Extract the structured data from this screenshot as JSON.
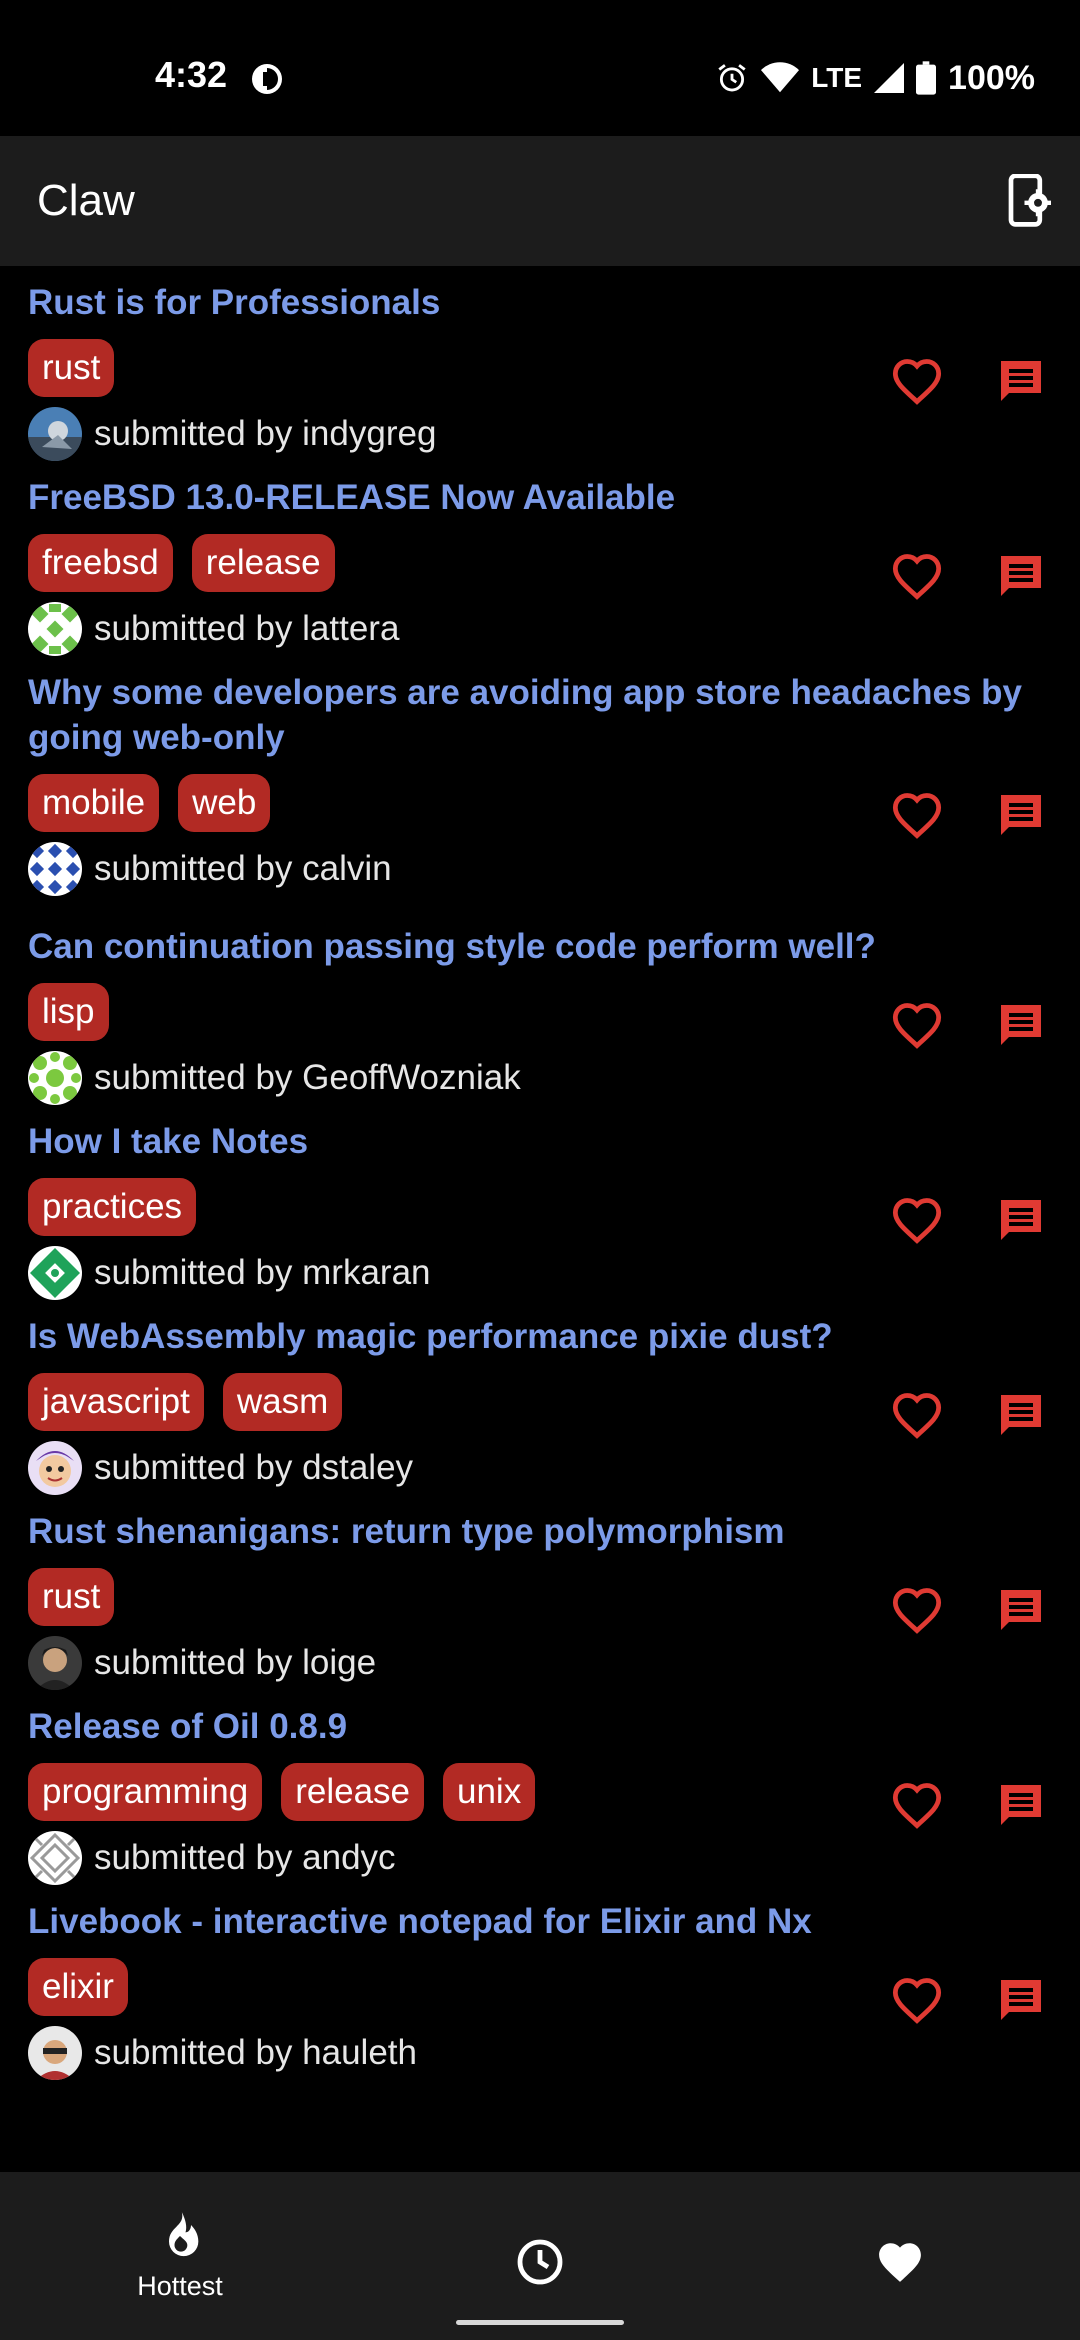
{
  "status_bar": {
    "time": "4:32",
    "network": "LTE",
    "battery": "100%",
    "icons": [
      "alarm-icon",
      "wifi-icon",
      "signal-icon",
      "battery-icon"
    ]
  },
  "app_bar": {
    "title": "Claw",
    "settings_icon": "app-settings-icon"
  },
  "colors": {
    "background": "#000000",
    "bar": "#1c1c1c",
    "title": "#7c9be8",
    "tag": "#b22a24",
    "accent": "#e03a33"
  },
  "stories": [
    {
      "title": "Rust is for Professionals",
      "tags": [
        "rust"
      ],
      "byline": "submitted by indygreg"
    },
    {
      "title": "FreeBSD 13.0-RELEASE Now Available",
      "tags": [
        "freebsd",
        "release"
      ],
      "byline": "submitted by lattera"
    },
    {
      "title": "Why some developers are avoiding app store headaches by going web-only",
      "tags": [
        "mobile",
        "web"
      ],
      "byline": "submitted by calvin"
    },
    {
      "title": "Can continuation passing style code perform well?",
      "tags": [
        "lisp"
      ],
      "byline": "submitted by GeoffWozniak"
    },
    {
      "title": "How I take Notes",
      "tags": [
        "practices"
      ],
      "byline": "submitted by mrkaran"
    },
    {
      "title": "Is WebAssembly magic performance pixie dust?",
      "tags": [
        "javascript",
        "wasm"
      ],
      "byline": "submitted by dstaley"
    },
    {
      "title": "Rust shenanigans: return type polymorphism",
      "tags": [
        "rust"
      ],
      "byline": "submitted by loige"
    },
    {
      "title": "Release of Oil 0.8.9",
      "tags": [
        "programming",
        "release",
        "unix"
      ],
      "byline": "submitted by andyc"
    },
    {
      "title": "Livebook - interactive notepad for Elixir and Nx",
      "tags": [
        "elixir"
      ],
      "byline": "submitted by hauleth"
    }
  ],
  "bottom_nav": {
    "items": [
      {
        "label": "Hottest",
        "icon": "flame-icon",
        "selected": true
      },
      {
        "label": "",
        "icon": "clock-icon",
        "selected": false
      },
      {
        "label": "",
        "icon": "heart-icon",
        "selected": false
      }
    ]
  }
}
